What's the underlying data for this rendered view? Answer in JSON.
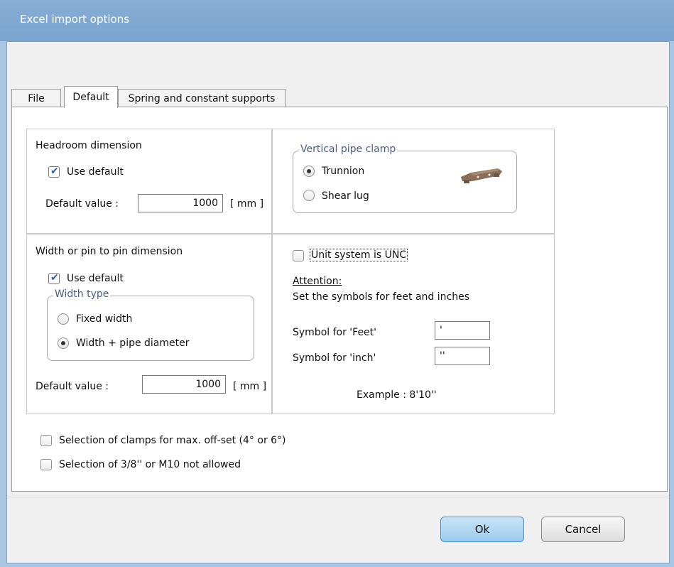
{
  "window": {
    "title": "Excel import options"
  },
  "tabs": [
    {
      "label": "File"
    },
    {
      "label": "Default"
    },
    {
      "label": "Spring and constant supports"
    }
  ],
  "headroom": {
    "title": "Headroom dimension",
    "use_default_label": "Use default",
    "use_default_checked": true,
    "default_value_label": "Default value :",
    "default_value": "1000",
    "unit": "[ mm ]"
  },
  "vertical_clamp": {
    "legend": "Vertical pipe clamp",
    "options": [
      {
        "label": "Trunnion",
        "selected": true
      },
      {
        "label": "Shear lug",
        "selected": false
      }
    ]
  },
  "width": {
    "title": "Width or pin to pin dimension",
    "use_default_label": "Use default",
    "use_default_checked": true,
    "width_type_legend": "Width type",
    "options": [
      {
        "label": "Fixed width",
        "selected": false
      },
      {
        "label": "Width + pipe diameter",
        "selected": true
      }
    ],
    "default_value_label": "Default value :",
    "default_value": "1000",
    "unit": "[ mm ]"
  },
  "units": {
    "unc_label": "Unit system is UNC",
    "unc_checked": false,
    "attention_label": "Attention:",
    "attention_text": "Set the symbols for feet and inches",
    "feet_label": "Symbol for 'Feet'",
    "feet_value": "'",
    "inch_label": "Symbol for 'inch'",
    "inch_value": "''",
    "example_text": "Example :   8'10''"
  },
  "options": {
    "max_offset_label": "Selection of clamps for max. off-set (4° or 6°)",
    "max_offset_checked": false,
    "m10_label": "Selection of 3/8'' or M10 not allowed",
    "m10_checked": false
  },
  "buttons": {
    "ok": "Ok",
    "cancel": "Cancel"
  },
  "colors": {
    "titlebar": "#7aa3cd",
    "frame": "#a9c6e4",
    "ok_button": "#9ccbed",
    "check_mark": "#2a5bb0"
  }
}
